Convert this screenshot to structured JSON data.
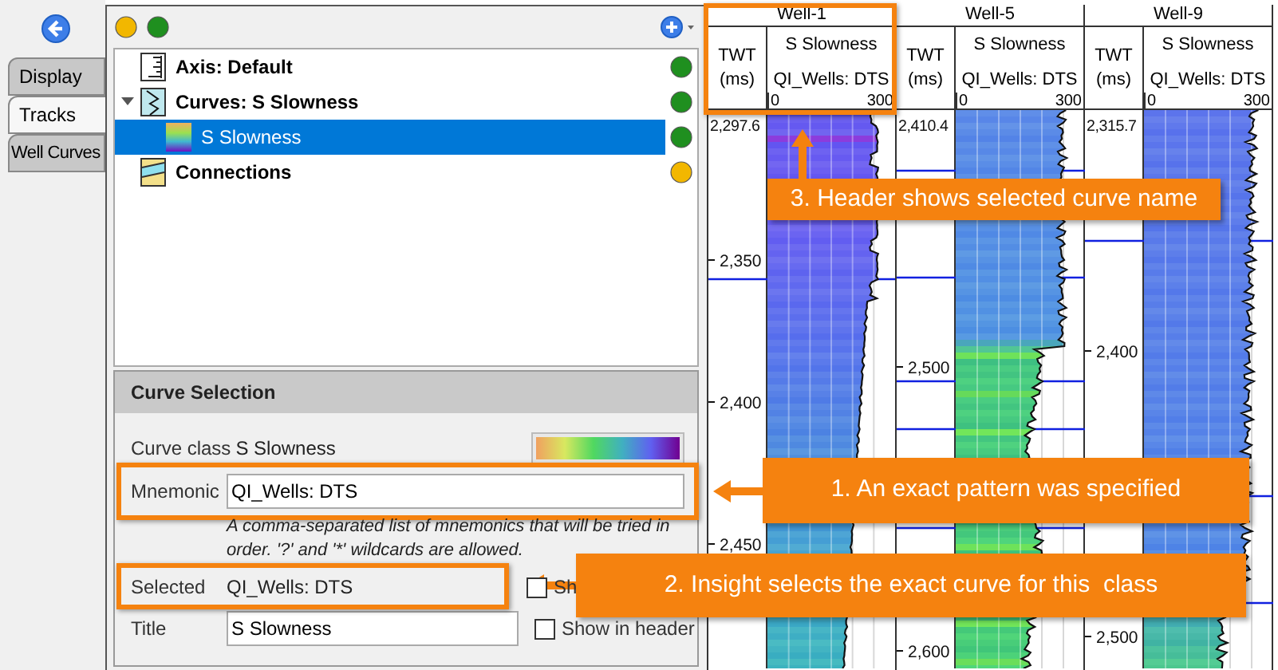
{
  "nav": {
    "tabs": [
      {
        "label": "Display",
        "selected": false
      },
      {
        "label": "Tracks",
        "selected": true
      },
      {
        "label": "Well Curves",
        "selected": false
      }
    ]
  },
  "toolbar": {
    "status_dots": [
      {
        "color": "#f2b700"
      },
      {
        "color": "#1f8f1f"
      }
    ]
  },
  "tree": {
    "items": [
      {
        "label": "Axis: Default",
        "kind": "axis",
        "selected": false,
        "color": "#1f8f1f"
      },
      {
        "label": "Curves: S Slowness",
        "kind": "curves",
        "selected": false,
        "expanded": true,
        "color": "#1f8f1f",
        "children": [
          {
            "label": "S Slowness",
            "kind": "curve",
            "selected": true,
            "color": "#1f8f1f"
          }
        ]
      },
      {
        "label": "Connections",
        "kind": "connections",
        "selected": false,
        "color": "#f2b700"
      }
    ]
  },
  "curve_selection": {
    "title": "Curve Selection",
    "curve_class_label": "Curve class",
    "curve_class": "S Slowness",
    "mnemonic_label": "Mnemonic",
    "mnemonic": "QI_Wells: DTS",
    "hint": "A comma-separated list of mnemonics that will be tried in order. '?' and '*' wildcards are allowed.",
    "selected_label": "Selected",
    "selected_value": "QI_Wells: DTS",
    "selected_checkbox": {
      "label": "Sh",
      "checked": false
    },
    "title_label": "Title",
    "title_value": "S Slowness",
    "show_in_header": {
      "label": "Show in header",
      "checked": false
    }
  },
  "wells": [
    {
      "name": "Well-1",
      "axis_title": "TWT (ms)",
      "curve_title": "S Slowness",
      "curve_mnemonic": "QI_Wells: DTS",
      "scale_min": "0",
      "scale_max": "300",
      "top_reading": "2,297.6",
      "depth_labels": [
        "2,350",
        "2,400",
        "2,450"
      ]
    },
    {
      "name": "Well-5",
      "axis_title": "TWT (ms)",
      "curve_title": "S Slowness",
      "curve_mnemonic": "QI_Wells: DTS",
      "scale_min": "0",
      "scale_max": "300",
      "top_reading": "2,410.4",
      "depth_labels": [
        "2,500",
        "2,600"
      ]
    },
    {
      "name": "Well-9",
      "axis_title": "TWT (ms)",
      "curve_title": "S Slowness",
      "curve_mnemonic": "QI_Wells: DTS",
      "scale_min": "0",
      "scale_max": "300",
      "top_reading": "2,315.7",
      "depth_labels": [
        "2,400",
        "2,500"
      ]
    }
  ],
  "callouts": [
    {
      "kind": "header",
      "text": "3. Header shows selected curve name"
    },
    {
      "kind": "mnemonic",
      "text": "1. An exact pattern was specified"
    },
    {
      "kind": "selected",
      "text": "2. Insight selects the exact curve for this  class"
    }
  ]
}
